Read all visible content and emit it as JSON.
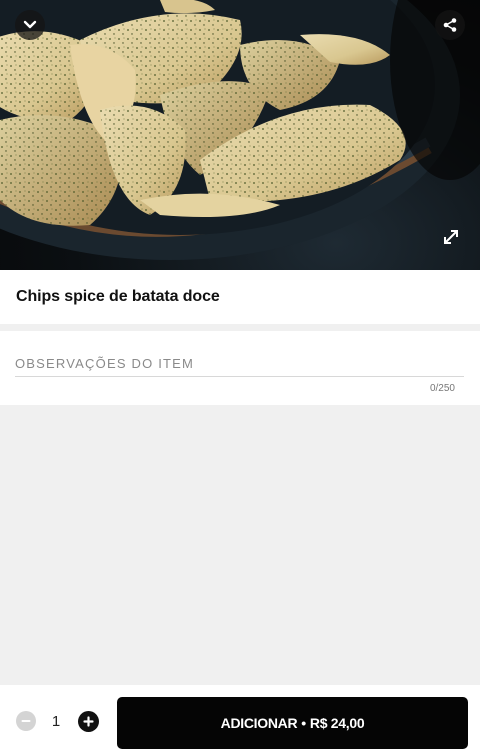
{
  "product": {
    "name": "Chips spice de batata doce",
    "image_alt": "Chips de batata doce em uma tigela"
  },
  "header": {
    "back_icon": "chevron-down-icon",
    "share_icon": "share-icon",
    "expand_icon": "expand-icon"
  },
  "notes": {
    "placeholder": "OBSERVAÇÕES DO ITEM",
    "value": "",
    "counter": "0/250"
  },
  "footer": {
    "quantity": "1",
    "add_label": "ADICIONAR",
    "separator": "•",
    "price": "R$ 24,00"
  }
}
